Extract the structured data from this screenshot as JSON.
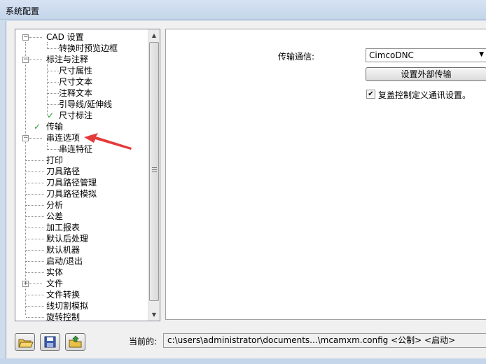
{
  "window": {
    "title": "系统配置"
  },
  "tree": {
    "items": [
      {
        "label": "CAD 设置"
      },
      {
        "label": "转换时预览边框"
      },
      {
        "label": "标注与注释"
      },
      {
        "label": "尺寸属性"
      },
      {
        "label": "尺寸文本"
      },
      {
        "label": "注释文本"
      },
      {
        "label": "引导线/延伸线"
      },
      {
        "label": "尺寸标注"
      },
      {
        "label": "传输"
      },
      {
        "label": "串连选项"
      },
      {
        "label": "串连特征"
      },
      {
        "label": "打印"
      },
      {
        "label": "刀具路径"
      },
      {
        "label": "刀具路径管理"
      },
      {
        "label": "刀具路径模拟"
      },
      {
        "label": "分析"
      },
      {
        "label": "公差"
      },
      {
        "label": "加工报表"
      },
      {
        "label": "默认后处理"
      },
      {
        "label": "默认机器"
      },
      {
        "label": "启动/退出"
      },
      {
        "label": "实体"
      },
      {
        "label": "文件"
      },
      {
        "label": "文件转换"
      },
      {
        "label": "线切割模拟"
      },
      {
        "label": "旋转控制"
      }
    ]
  },
  "settings": {
    "comm_label": "传输通信:",
    "comm_value": "CimcoDNC",
    "external_button": "设置外部传输",
    "override_label": "复盖控制定义通讯设置。",
    "override_checked": true
  },
  "footer": {
    "current_label": "当前的:",
    "current_path": "c:\\users\\administrator\\documents...\\mcamxm.config <公制> <启动>"
  },
  "colors": {
    "annotation_arrow": "#e53a3a",
    "check_green": "#2e9e2e"
  }
}
